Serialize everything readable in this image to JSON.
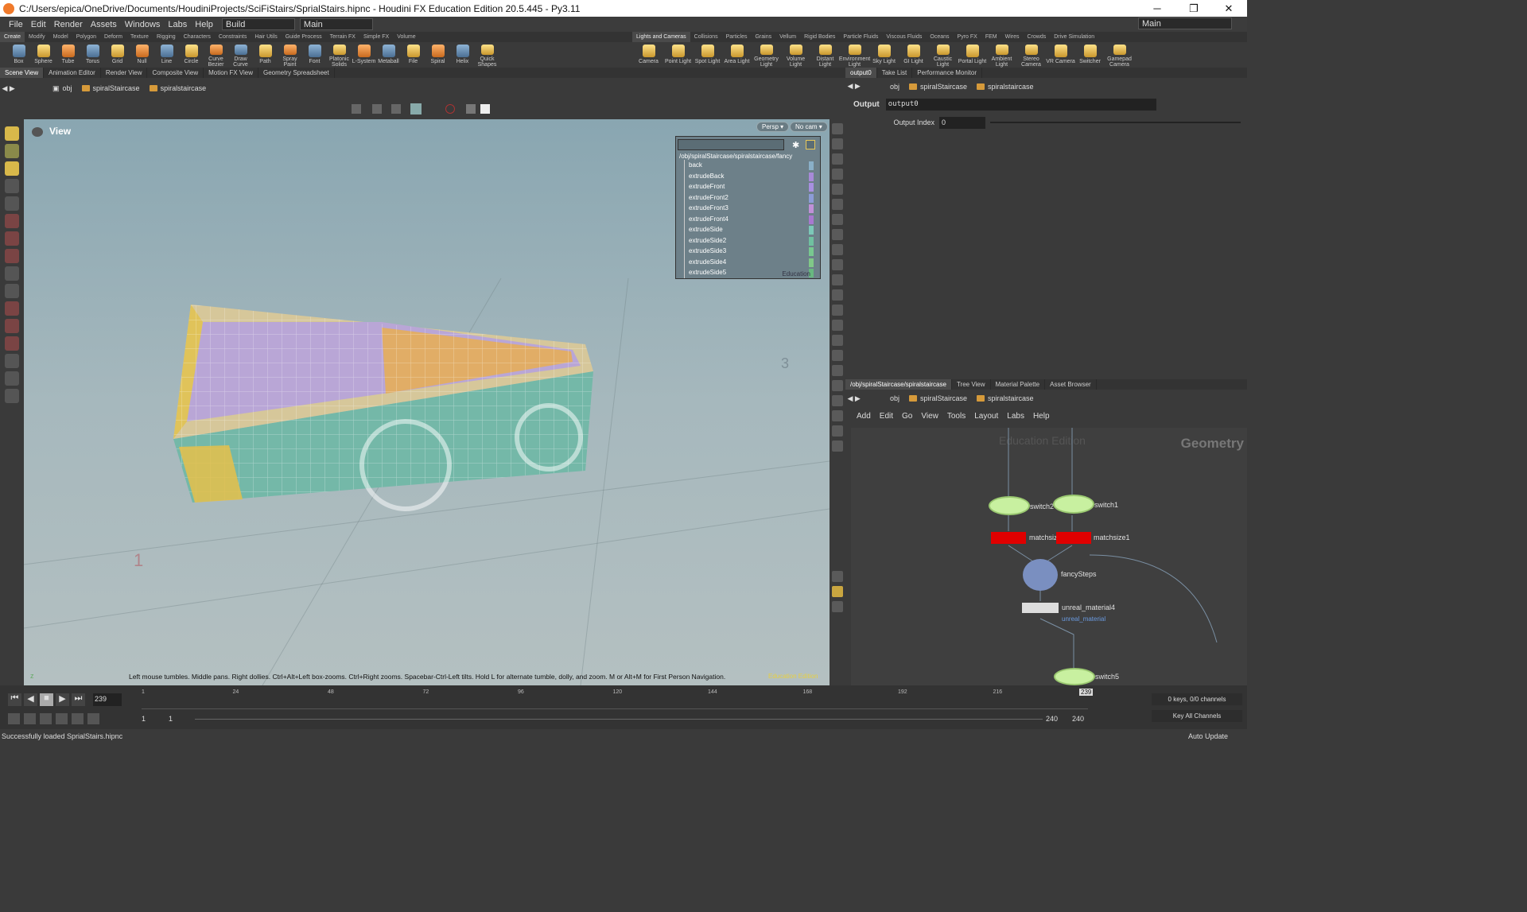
{
  "window": {
    "title": "C:/Users/epica/OneDrive/Documents/HoudiniProjects/SciFiStairs/SprialStairs.hipnc - Houdini FX Education Edition 20.5.445 - Py3.11"
  },
  "menu": {
    "items": [
      "File",
      "Edit",
      "Render",
      "Assets",
      "Windows",
      "Labs",
      "Help"
    ],
    "build": "Build",
    "desktop": "Main",
    "desktop_right": "Main"
  },
  "shelf_tabs_left": [
    "Create",
    "Modify",
    "Model",
    "Polygon",
    "Deform",
    "Texture",
    "Rigging",
    "Characters",
    "Constraints",
    "Hair Utils",
    "Guide Process",
    "Terrain FX",
    "Simple FX",
    "Volume"
  ],
  "shelf_tabs_right": [
    "Lights and Cameras",
    "Collisions",
    "Particles",
    "Grains",
    "Vellum",
    "Rigid Bodies",
    "Particle Fluids",
    "Viscous Fluids",
    "Oceans",
    "Pyro FX",
    "FEM",
    "Wires",
    "Crowds",
    "Drive Simulation"
  ],
  "tools_left": [
    "Box",
    "Sphere",
    "Tube",
    "Torus",
    "Grid",
    "Null",
    "Line",
    "Circle",
    "Curve Bezier",
    "Draw Curve",
    "Path",
    "Spray Paint",
    "Font",
    "Platonic Solids",
    "L-System",
    "Metaball",
    "File",
    "Spiral",
    "Helix",
    "Quick Shapes"
  ],
  "tools_right": [
    "Camera",
    "Point Light",
    "Spot Light",
    "Area Light",
    "Geometry Light",
    "Volume Light",
    "Distant Light",
    "Environment Light",
    "Sky Light",
    "GI Light",
    "Caustic Light",
    "Portal Light",
    "Ambient Light",
    "Stereo Camera",
    "VR Camera",
    "Switcher",
    "Gamepad Camera"
  ],
  "left_panel_tabs": [
    "Scene View",
    "Animation Editor",
    "Render View",
    "Composite View",
    "Motion FX View",
    "Geometry Spreadsheet"
  ],
  "right_top_tabs": [
    "output0",
    "Take List",
    "Performance Monitor"
  ],
  "right_bottom_tabs": [
    "/obj/spiralStaircase/spiralstaircase",
    "Tree View",
    "Material Palette",
    "Asset Browser"
  ],
  "path": {
    "obj": "obj",
    "node1": "spiralStaircase",
    "node2": "spiralstaircase"
  },
  "path_right": {
    "obj": "obj",
    "node1": "spiralStaircase",
    "node2": "spiralstaircase"
  },
  "path_net": {
    "obj": "obj",
    "node1": "spiralStaircase",
    "node2": "spiralstaircase"
  },
  "viewport": {
    "label": "View",
    "persp": "Persp",
    "cam": "No cam",
    "watermark": "Education Edition",
    "hint": "Left mouse tumbles. Middle pans. Right dollies. Ctrl+Alt+Left box-zooms. Ctrl+Right zooms. Spacebar-Ctrl-Left tilts. Hold L for alternate tumble, dolly, and zoom. M or Alt+M for First Person Navigation.",
    "num3": "3",
    "num1": "1"
  },
  "group_list": {
    "path": "/obj/spiralStaircase/spiralstaircase/fancy",
    "items": [
      "back",
      "extrudeBack",
      "extrudeFront",
      "extrudeFront2",
      "extrudeFront3",
      "extrudeFront4",
      "extrudeSide",
      "extrudeSide2",
      "extrudeSide3",
      "extrudeSide4",
      "extrudeSide5"
    ],
    "colors": [
      "#8ab0c8",
      "#a88ad8",
      "#a890e0",
      "#8c9cd8",
      "#c090d8",
      "#a878d0",
      "#7cc8b8",
      "#70c0a0",
      "#78c890",
      "#80c888",
      "#68b880"
    ],
    "edu": "Education"
  },
  "parms": {
    "type": "Output",
    "name": "output0",
    "label": "Output Index",
    "value": "0"
  },
  "net_menu": [
    "Add",
    "Edit",
    "Go",
    "View",
    "Tools",
    "Layout",
    "Labs",
    "Help"
  ],
  "net": {
    "watermark": "Education Edition",
    "context": "Geometry",
    "nodes": {
      "switch2": "switch2",
      "switch1": "switch1",
      "matchsize2": "matchsize2",
      "matchsize1": "matchsize1",
      "fancy": "fancySteps",
      "material": "unreal_material4",
      "material_sub": "unreal_material",
      "switch5": "switch5"
    }
  },
  "timeline": {
    "frame": "239",
    "ticks": [
      "1",
      "24",
      "48",
      "72",
      "96",
      "120",
      "144",
      "168",
      "192",
      "216"
    ],
    "current": "239",
    "start": "1",
    "start2": "1",
    "end": "240",
    "end2": "240",
    "keys": "0 keys, 0/0 channels",
    "keyall": "Key All Channels"
  },
  "status": {
    "message": "Successfully loaded SprialStairs.hipnc",
    "update": "Auto Update"
  }
}
